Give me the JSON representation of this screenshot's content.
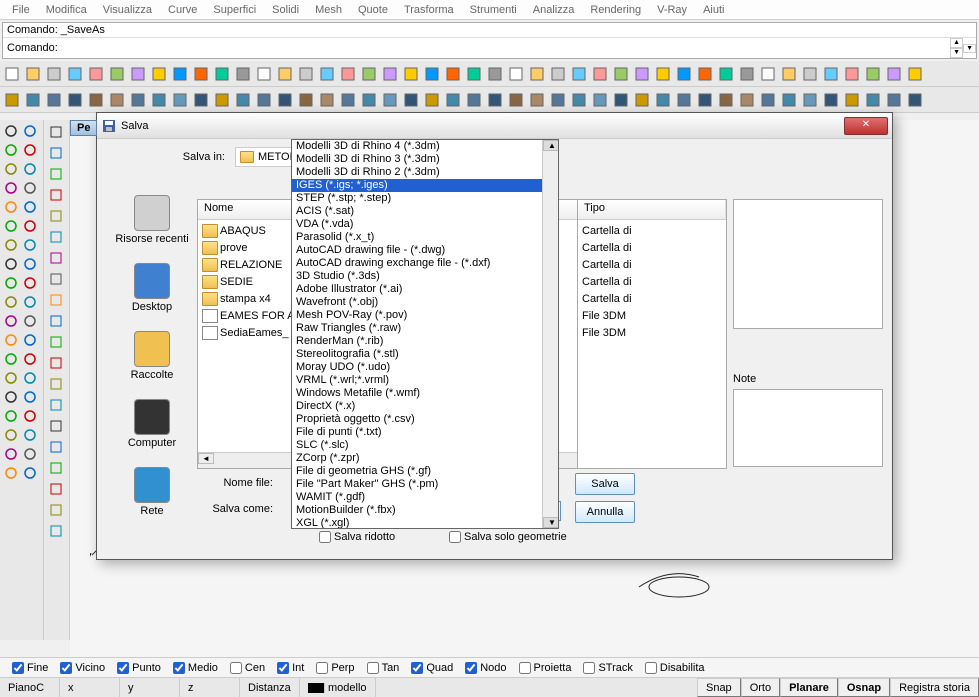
{
  "menu": [
    "File",
    "Modifica",
    "Visualizza",
    "Curve",
    "Superfici",
    "Solidi",
    "Mesh",
    "Quote",
    "Trasforma",
    "Strumenti",
    "Analizza",
    "Rendering",
    "V-Ray",
    "Aiuti"
  ],
  "command": {
    "history": "Comando: _SaveAs",
    "prompt": "Comando:"
  },
  "viewport_tab": "Pe",
  "axis": {
    "x": "x",
    "y": "y",
    "z": "z"
  },
  "dialog": {
    "title": "Salva",
    "save_in_label": "Salva in:",
    "save_in_value": "METODO DEG",
    "columns": {
      "name": "Nome",
      "type": "Tipo"
    },
    "files": [
      {
        "name": "ABAQUS",
        "kind": "folder",
        "type": "Cartella di"
      },
      {
        "name": "prove",
        "kind": "folder",
        "type": "Cartella di"
      },
      {
        "name": "RELAZIONE",
        "kind": "folder",
        "type": "Cartella di"
      },
      {
        "name": "SEDIE",
        "kind": "folder",
        "type": "Cartella di"
      },
      {
        "name": "stampa x4",
        "kind": "folder",
        "type": "Cartella di"
      },
      {
        "name": "EAMES FOR A",
        "kind": "file",
        "type": "File 3DM"
      },
      {
        "name": "SediaEames_",
        "kind": "file",
        "type": "File 3DM"
      }
    ],
    "places": [
      {
        "label": "Risorse recenti"
      },
      {
        "label": "Desktop"
      },
      {
        "label": "Raccolte"
      },
      {
        "label": "Computer"
      },
      {
        "label": "Rete"
      }
    ],
    "note_label": "Note",
    "filename_label": "Nome file:",
    "savetype_label": "Salva come:",
    "savetype_value": "Modelli 3D di Rhino 4 (*.3dm)",
    "save_btn": "Salva",
    "cancel_btn": "Annulla",
    "cb_small": "Salva ridotto",
    "cb_geom": "Salva solo geometrie",
    "formats": [
      "Modelli 3D di Rhino 4 (*.3dm)",
      "Modelli 3D di Rhino 3 (*.3dm)",
      "Modelli 3D di Rhino 2 (*.3dm)",
      "IGES (*.igs; *.iges)",
      "STEP (*.stp; *.step)",
      "ACIS (*.sat)",
      "VDA (*.vda)",
      "Parasolid (*.x_t)",
      "AutoCAD drawing file - (*.dwg)",
      "AutoCAD drawing exchange file - (*.dxf)",
      "3D Studio (*.3ds)",
      "Adobe Illustrator (*.ai)",
      "Wavefront (*.obj)",
      "Mesh POV-Ray (*.pov)",
      "Raw Triangles (*.raw)",
      "RenderMan (*.rib)",
      "Stereolitografia (*.stl)",
      "Moray UDO (*.udo)",
      "VRML (*.wrl;*.vrml)",
      "Windows Metafile (*.wmf)",
      "DirectX (*.x)",
      "Proprietà oggetto (*.csv)",
      "File di punti (*.txt)",
      "SLC (*.slc)",
      "ZCorp (*.zpr)",
      "File di geometria GHS (*.gf)",
      "File \"Part Maker\" GHS (*.pm)",
      "WAMIT (*.gdf)",
      "MotionBuilder (*.fbx)",
      "XGL (*.xgl)"
    ],
    "selected_format_index": 3
  },
  "osnap": [
    {
      "label": "Fine",
      "checked": true
    },
    {
      "label": "Vicino",
      "checked": true
    },
    {
      "label": "Punto",
      "checked": true
    },
    {
      "label": "Medio",
      "checked": true
    },
    {
      "label": "Cen",
      "checked": false
    },
    {
      "label": "Int",
      "checked": true
    },
    {
      "label": "Perp",
      "checked": false
    },
    {
      "label": "Tan",
      "checked": false
    },
    {
      "label": "Quad",
      "checked": true
    },
    {
      "label": "Nodo",
      "checked": true
    },
    {
      "label": "Proietta",
      "checked": false
    },
    {
      "label": "STrack",
      "checked": false
    },
    {
      "label": "Disabilita",
      "checked": false
    }
  ],
  "statusbar": {
    "items": [
      "PianoC",
      "x",
      "y",
      "z",
      "Distanza"
    ],
    "model": "modello",
    "buttons": [
      "Snap",
      "Orto",
      "Planare",
      "Osnap",
      "Registra storia"
    ]
  }
}
